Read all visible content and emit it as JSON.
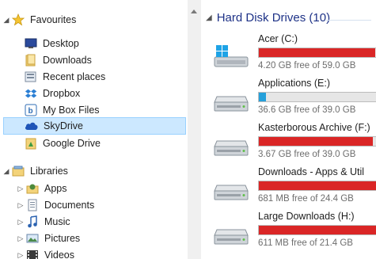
{
  "nav": {
    "favourites": {
      "label": "Favourites",
      "items": [
        {
          "label": "Desktop",
          "icon": "desktop-icon"
        },
        {
          "label": "Downloads",
          "icon": "downloads-folder-icon"
        },
        {
          "label": "Recent places",
          "icon": "recent-places-icon"
        },
        {
          "label": "Dropbox",
          "icon": "dropbox-icon"
        },
        {
          "label": "My Box Files",
          "icon": "box-icon"
        },
        {
          "label": "SkyDrive",
          "icon": "skydrive-icon"
        },
        {
          "label": "Google Drive",
          "icon": "google-drive-icon"
        }
      ]
    },
    "libraries": {
      "label": "Libraries",
      "items": [
        {
          "label": "Apps",
          "icon": "apps-library-icon"
        },
        {
          "label": "Documents",
          "icon": "documents-library-icon"
        },
        {
          "label": "Music",
          "icon": "music-library-icon"
        },
        {
          "label": "Pictures",
          "icon": "pictures-library-icon"
        },
        {
          "label": "Videos",
          "icon": "videos-library-icon"
        }
      ]
    },
    "selected": "SkyDrive"
  },
  "content": {
    "section_title": "Hard Disk Drives (10)",
    "drives": [
      {
        "name": "Acer (C:)",
        "free_text": "4.20 GB free of 59.0 GB",
        "used_fraction": 0.93,
        "bar_color": "#da2626",
        "icon": "windows-drive-icon"
      },
      {
        "name": "Applications (E:)",
        "free_text": "36.6 GB free of 39.0 GB",
        "used_fraction": 0.06,
        "bar_color": "#26a0da",
        "icon": "hard-drive-icon"
      },
      {
        "name": "Kasterborous Archive (F:)",
        "free_text": "3.67 GB free of 39.0 GB",
        "used_fraction": 0.91,
        "bar_color": "#da2626",
        "icon": "hard-drive-icon"
      },
      {
        "name": "Downloads - Apps & Util",
        "free_text": "681 MB free of 24.4 GB",
        "used_fraction": 0.97,
        "bar_color": "#da2626",
        "icon": "hard-drive-icon"
      },
      {
        "name": "Large Downloads (H:)",
        "free_text": "611 MB free of 21.4 GB",
        "used_fraction": 0.97,
        "bar_color": "#da2626",
        "icon": "hard-drive-icon"
      }
    ]
  }
}
